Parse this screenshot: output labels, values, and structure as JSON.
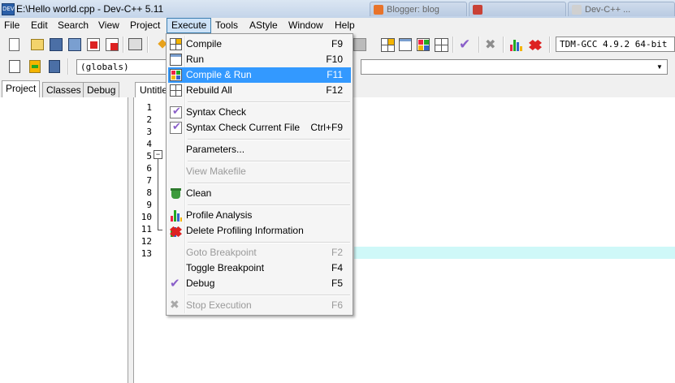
{
  "window": {
    "title": "E:\\Hello world.cpp - Dev-C++ 5.11",
    "background_tabs": [
      "Blogger: blog",
      "",
      "",
      "",
      "Dev-C++ ..."
    ]
  },
  "menubar": [
    "File",
    "Edit",
    "Search",
    "View",
    "Project",
    "Execute",
    "Tools",
    "AStyle",
    "Window",
    "Help"
  ],
  "toolbar": {
    "compiler": "TDM-GCC 4.9.2 64-bit",
    "scope": "(globals)",
    "members": ""
  },
  "left_tabs": [
    "Project",
    "Classes",
    "Debug"
  ],
  "editor": {
    "tab": "Untitled",
    "line_numbers": [
      "1",
      "2",
      "3",
      "4",
      "5",
      "6",
      "7",
      "8",
      "9",
      "10",
      "11",
      "12",
      "13"
    ]
  },
  "execute_menu": {
    "items": [
      {
        "label": "Compile",
        "shortcut": "F9",
        "icon": "compile-icon"
      },
      {
        "label": "Run",
        "shortcut": "F10",
        "icon": "run-icon"
      },
      {
        "label": "Compile & Run",
        "shortcut": "F11",
        "icon": "compile-run-icon",
        "highlighted": true
      },
      {
        "label": "Rebuild All",
        "shortcut": "F12",
        "icon": "rebuild-icon"
      },
      {
        "label": "Syntax Check",
        "shortcut": "",
        "icon": "syntax-check-icon"
      },
      {
        "label": "Syntax Check Current File",
        "shortcut": "Ctrl+F9",
        "icon": "syntax-check-file-icon"
      },
      {
        "label": "Parameters...",
        "shortcut": ""
      },
      {
        "label": "View Makefile",
        "shortcut": "",
        "disabled": true
      },
      {
        "label": "Clean",
        "shortcut": "",
        "icon": "clean-icon"
      },
      {
        "label": "Profile Analysis",
        "shortcut": "",
        "icon": "profile-icon"
      },
      {
        "label": "Delete Profiling Information",
        "shortcut": "",
        "icon": "delete-profile-icon"
      },
      {
        "label": "Goto Breakpoint",
        "shortcut": "F2",
        "disabled": true
      },
      {
        "label": "Toggle Breakpoint",
        "shortcut": "F4"
      },
      {
        "label": "Debug",
        "shortcut": "F5",
        "icon": "debug-check-icon"
      },
      {
        "label": "Stop Execution",
        "shortcut": "F6",
        "icon": "stop-icon",
        "disabled": true
      }
    ]
  },
  "colors": {
    "highlight": "#3399ff",
    "current_line": "#cff8f8"
  }
}
